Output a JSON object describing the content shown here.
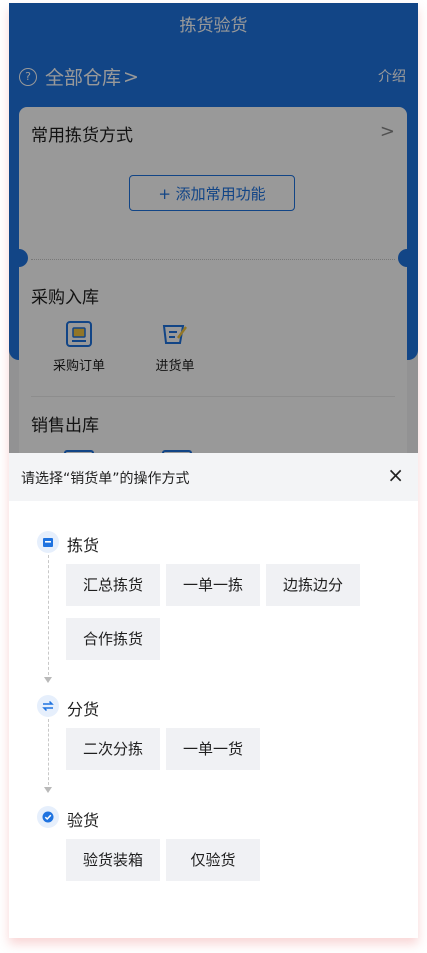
{
  "app": {
    "title": "拣货验货",
    "warehouse_label": "全部仓库",
    "warehouse_arrow": ">",
    "help_glyph": "?",
    "intro_link": "介绍"
  },
  "common_methods": {
    "title": "常用拣货方式",
    "chevron": ">",
    "add_button": "+ 添加常用功能"
  },
  "purchase_section": {
    "title": "采购入库",
    "items": [
      {
        "label": "采购订单",
        "icon": "purchase-order-icon"
      },
      {
        "label": "进货单",
        "icon": "receipt-icon"
      }
    ]
  },
  "sales_section": {
    "title": "销售出库"
  },
  "sheet": {
    "title": "请选择“销货单”的操作方式",
    "close_glyph": "×",
    "stages": [
      {
        "label": "拣货",
        "icon": "box-icon",
        "options": [
          "汇总拣货",
          "一单一拣",
          "边拣边分",
          "合作拣货"
        ]
      },
      {
        "label": "分货",
        "icon": "swap-icon",
        "options": [
          "二次分拣",
          "一单一货"
        ]
      },
      {
        "label": "验货",
        "icon": "check-badge-icon",
        "options": [
          "验货装箱",
          "仅验货"
        ]
      }
    ]
  },
  "colors": {
    "brand_blue": "#1f73e0",
    "chip_bg": "#f0f1f4",
    "sheet_header_bg": "#f3f4f6"
  }
}
